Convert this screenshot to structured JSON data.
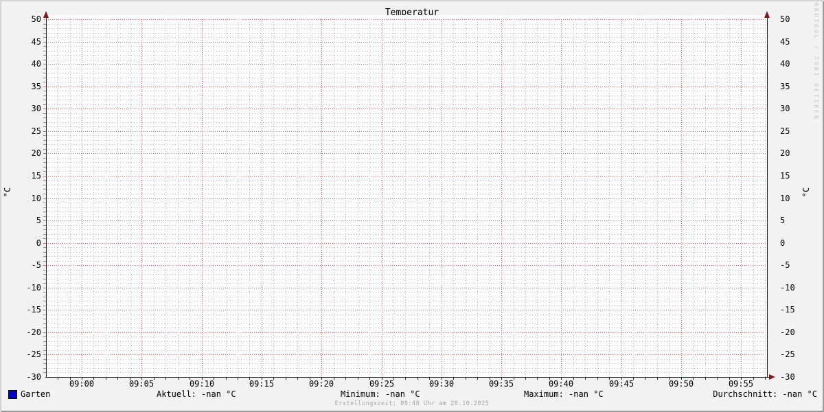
{
  "title": "Temperatur",
  "watermark": "RRDTOOL / TOBI OETIKER",
  "y_axis": {
    "left_label": "°C",
    "right_label": "°C"
  },
  "footer": "Erstellungszeit: 09:48 Uhr am 28.10.2025",
  "legend": {
    "series_label": "Garten",
    "stats": {
      "aktuell": "Aktuell: -nan °C",
      "minimum": "Minimum: -nan °C",
      "maximum": "Maximum: -nan °C",
      "durchschnitt": "Durchschnitt: -nan °C"
    }
  },
  "colors": {
    "background": "#f2f2f2",
    "canvas": "#ffffff",
    "major_grid": "#dd5c5c",
    "minor_grid": "#b5b5b5",
    "axis": "#222222",
    "arrow": "#801a1a",
    "series_garten": "#0000cc",
    "footer_text": "#a3a3a3",
    "watermark_text": "#c2c2c2"
  },
  "chart_data": {
    "type": "line",
    "title": "Temperatur",
    "ylabel": "°C",
    "ylim": [
      -30,
      50
    ],
    "y_tick_step": 5,
    "y_minor_step": 1,
    "y_ticks": [
      50,
      45,
      40,
      35,
      30,
      25,
      20,
      15,
      10,
      5,
      0,
      -5,
      -10,
      -15,
      -20,
      -25,
      -30
    ],
    "x_ticks": [
      "09:00",
      "09:05",
      "09:10",
      "09:15",
      "09:20",
      "09:25",
      "09:30",
      "09:35",
      "09:40",
      "09:45",
      "09:50",
      "09:55"
    ],
    "x_major_step_minutes": 5,
    "x_minor_step_minutes": 1,
    "grid": true,
    "legend_position": "bottom",
    "series": [
      {
        "name": "Garten",
        "color": "#0000cc",
        "values": []
      }
    ],
    "stats": {
      "aktuell": "-nan °C",
      "minimum": "-nan °C",
      "maximum": "-nan °C",
      "durchschnitt": "-nan °C"
    }
  }
}
